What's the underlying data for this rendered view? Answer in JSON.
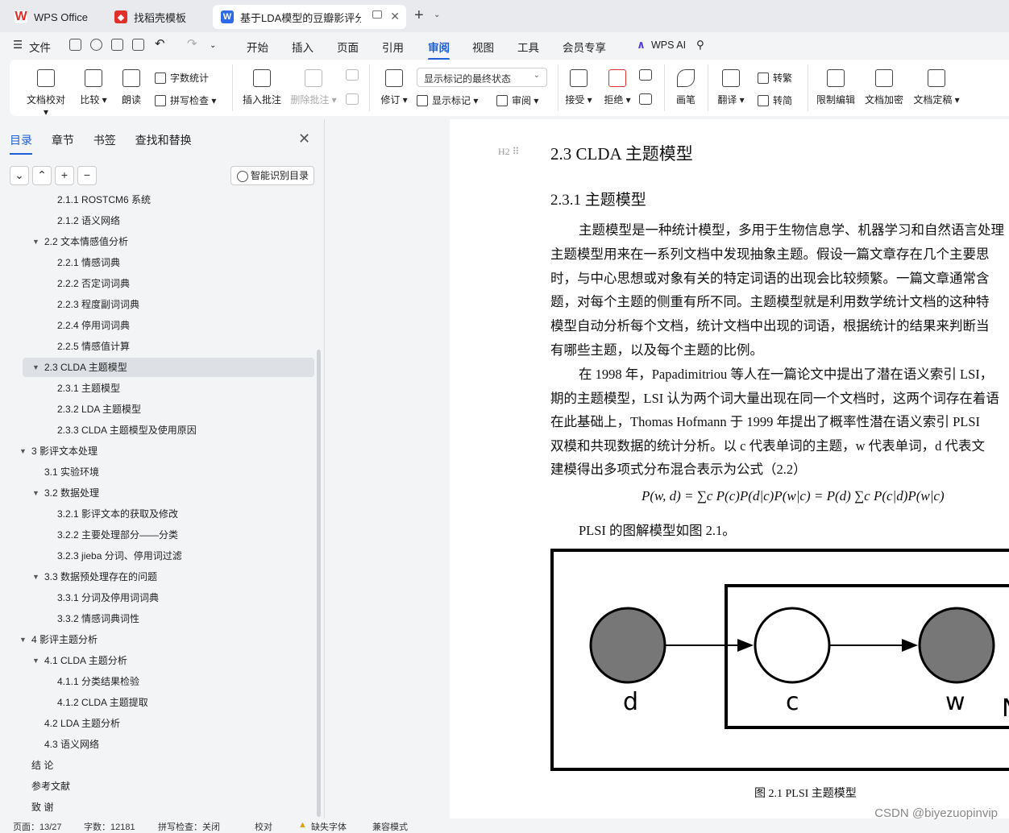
{
  "tabs": {
    "wps": "WPS Office",
    "template": "找稻壳模板",
    "doc": "基于LDA模型的豆瓣影评分析"
  },
  "menu": {
    "file": "文件",
    "items": [
      "开始",
      "插入",
      "页面",
      "引用",
      "审阅",
      "视图",
      "工具",
      "会员专享"
    ],
    "ai": "WPS AI"
  },
  "ribbon": {
    "proof": "文档校对",
    "compare": "比较",
    "read": "朗读",
    "wordcount": "字数统计",
    "spellcheck": "拼写检查",
    "insert_comment": "插入批注",
    "delete_comment": "删除批注",
    "revise": "修订",
    "markup_state": "显示标记的最终状态",
    "show_markup": "显示标记",
    "review": "审阅",
    "accept": "接受",
    "reject": "拒绝",
    "pen": "画笔",
    "translate": "翻译",
    "to_traditional": "转繁",
    "to_simplified": "转简",
    "restrict_edit": "限制编辑",
    "encrypt": "文档加密",
    "finalize": "文档定稿"
  },
  "sidebar": {
    "tabs": [
      "目录",
      "章节",
      "书签",
      "查找和替换"
    ],
    "smart_toc": "智能识别目录",
    "toc": [
      {
        "text": "2.1.1  ROSTCM6 系统",
        "level": 3
      },
      {
        "text": "2.1.2  语义网络",
        "level": 3
      },
      {
        "text": "2.2  文本情感值分析",
        "level": 2,
        "expanded": true
      },
      {
        "text": "2.2.1  情感词典",
        "level": 3
      },
      {
        "text": "2.2.2  否定词词典",
        "level": 3
      },
      {
        "text": "2.2.3  程度副词词典",
        "level": 3
      },
      {
        "text": "2.2.4  停用词词典",
        "level": 3
      },
      {
        "text": "2.2.5  情感值计算",
        "level": 3
      },
      {
        "text": "2.3 CLDA 主题模型",
        "level": 2,
        "expanded": true,
        "selected": true
      },
      {
        "text": "2.3.1  主题模型",
        "level": 3
      },
      {
        "text": "2.3.2 LDA 主题模型",
        "level": 3
      },
      {
        "text": "2.3.3 CLDA 主题模型及使用原因",
        "level": 3
      },
      {
        "text": "3  影评文本处理",
        "level": 1,
        "expanded": true
      },
      {
        "text": "3.1  实验环境",
        "level": 2
      },
      {
        "text": "3.2  数据处理",
        "level": 2,
        "expanded": true
      },
      {
        "text": "3.2.1  影评文本的获取及修改",
        "level": 3
      },
      {
        "text": "3.2.2  主要处理部分——分类",
        "level": 3
      },
      {
        "text": "3.2.3 jieba 分词、停用词过滤",
        "level": 3
      },
      {
        "text": "3.3  数据预处理存在的问题",
        "level": 2,
        "expanded": true
      },
      {
        "text": "3.3.1  分词及停用词词典",
        "level": 3
      },
      {
        "text": "3.3.2  情感词典词性",
        "level": 3
      },
      {
        "text": "4  影评主题分析",
        "level": 1,
        "expanded": true
      },
      {
        "text": "4.1 CLDA 主题分析",
        "level": 2,
        "expanded": true
      },
      {
        "text": "4.1.1  分类结果检验",
        "level": 3
      },
      {
        "text": "4.1.2 CLDA 主题提取",
        "level": 3
      },
      {
        "text": "4.2 LDA 主题分析",
        "level": 2
      },
      {
        "text": "4.3  语义网络",
        "level": 2
      },
      {
        "text": "结  论",
        "level": 1
      },
      {
        "text": "参考文献",
        "level": 1
      },
      {
        "text": "致  谢",
        "level": 1
      }
    ]
  },
  "document": {
    "heading_mark": "H2",
    "h2": "2.3 CLDA 主题模型",
    "h3": "2.3.1  主题模型",
    "paragraph_lines": [
      "主题模型是一种统计模型，多用于生物信息学、机器学习和自然语言处理",
      "主题模型用来在一系列文档中发现抽象主题。假设一篇文章存在几个主要思",
      "时，与中心思想或对象有关的特定词语的出现会比较频繁。一篇文章通常含",
      "题，对每个主题的侧重有所不同。主题模型就是利用数学统计文档的这种特",
      "模型自动分析每个文档，统计文档中出现的词语，根据统计的结果来判断当",
      "有哪些主题，以及每个主题的比例。",
      "在 1998 年，Papadimitriou 等人在一篇论文中提出了潜在语义索引 LSI，",
      "期的主题模型，LSI 认为两个词大量出现在同一个文档时，这两个词存在着语",
      "在此基础上，Thomas Hofmann 于 1999 年提出了概率性潜在语义索引 PLSI",
      "双模和共现数据的统计分析。以 c 代表单词的主题，w 代表单词，d 代表文",
      "建模得出多项式分布混合表示为公式（2.2）"
    ],
    "formula": "P(w, d) = ∑c P(c)P(d|c)P(w|c) = P(d) ∑c P(c|d)P(w|c)",
    "after_formula": "PLSI 的图解模型如图 2.1。",
    "figure": {
      "nodes": [
        "d",
        "c",
        "w"
      ],
      "plate_label": "N"
    },
    "caption": "图 2.1 PLSI 主题模型"
  },
  "status": {
    "page": "页面：13/27",
    "words": "字数：12181",
    "spell": "拼写检查：关闭",
    "proof": "校对",
    "missing_font": "缺失字体",
    "compat": "兼容模式"
  },
  "watermark": "CSDN @biyezuopinvip"
}
